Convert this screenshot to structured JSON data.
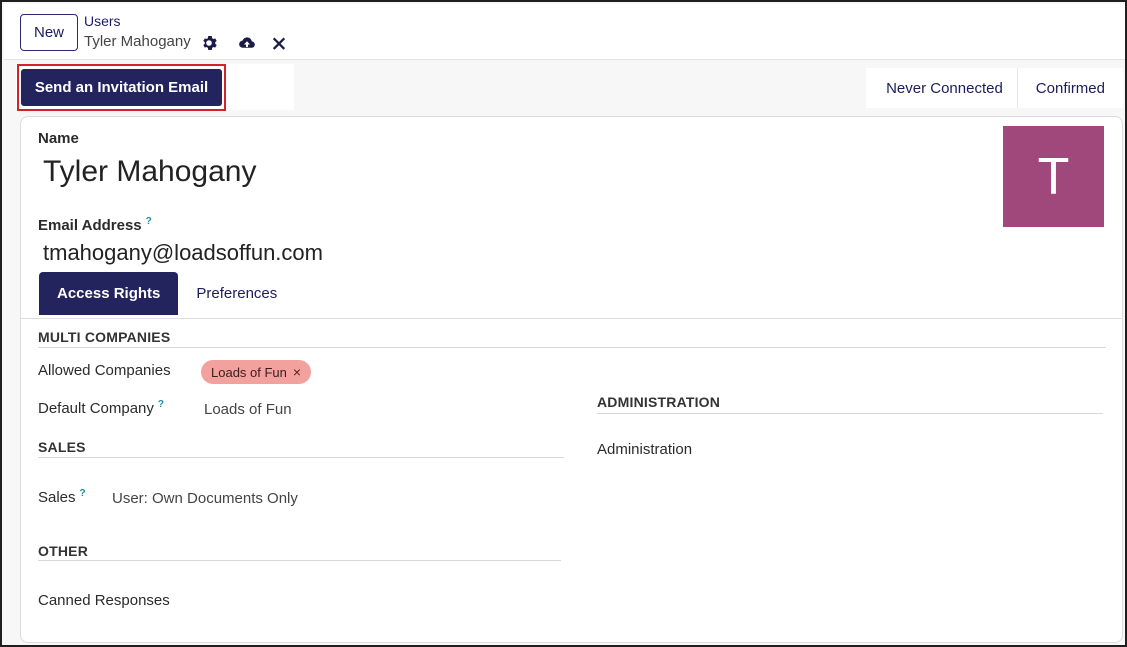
{
  "control_panel": {
    "new_label": "New",
    "breadcrumb_parent": "Users",
    "breadcrumb_current": "Tyler Mahogany",
    "icons": [
      "gear-icon",
      "cloud-upload-icon",
      "discard-icon"
    ]
  },
  "actions": {
    "invite_label": "Send an Invitation Email"
  },
  "status": {
    "items": [
      "Never Connected",
      "Confirmed"
    ]
  },
  "form": {
    "name_label": "Name",
    "name_value": "Tyler Mahogany",
    "email_label": "Email Address",
    "email_value": "tmahogany@loadsoffun.com",
    "help_mark": "?",
    "avatar_letter": "T",
    "avatar_color": "#a0477b"
  },
  "tabs": [
    {
      "label": "Access Rights",
      "active": true
    },
    {
      "label": "Preferences",
      "active": false
    }
  ],
  "access": {
    "multi_companies_title": "MULTI COMPANIES",
    "allowed_companies_label": "Allowed Companies",
    "allowed_company_tag": "Loads of Fun",
    "tag_remove": "×",
    "default_company_label": "Default Company",
    "default_company_value": "Loads of Fun",
    "sales_title": "SALES",
    "sales_label": "Sales",
    "sales_value": "User: Own Documents Only",
    "other_title": "OTHER",
    "canned_label": "Canned Responses",
    "administration_title": "ADMINISTRATION",
    "administration_label": "Administration"
  },
  "colors": {
    "primary": "#23235e",
    "highlight_border": "#d6202a",
    "tag_bg": "#f2a19f"
  }
}
